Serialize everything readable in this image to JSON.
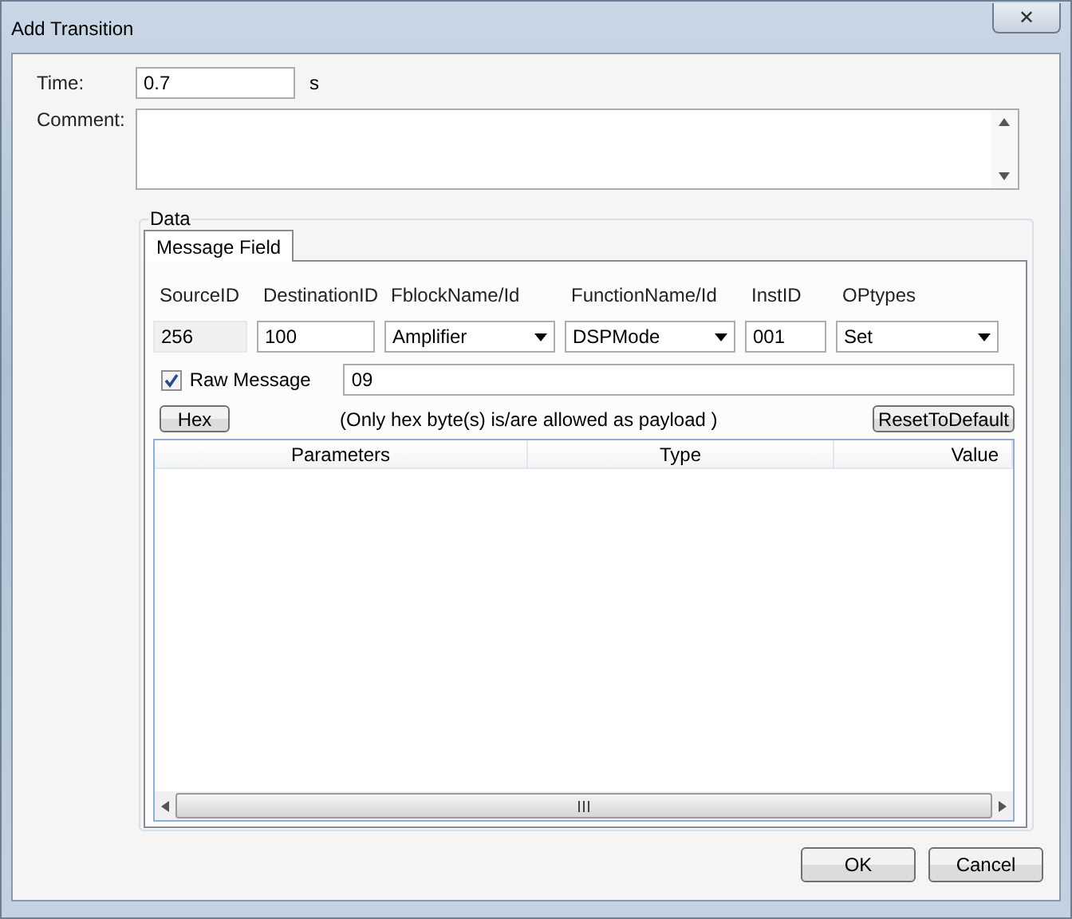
{
  "window": {
    "title": "Add Transition",
    "close": "✕"
  },
  "time": {
    "label": "Time:",
    "value": "0.7",
    "unit": "s"
  },
  "comment": {
    "label": "Comment:"
  },
  "data_group": {
    "label": "Data"
  },
  "tabs": [
    {
      "label": "Message Field",
      "selected": true
    }
  ],
  "fields": [
    {
      "label": "SourceID",
      "value": "256",
      "kind": "text",
      "disabled": true
    },
    {
      "label": "DestinationID",
      "value": "100",
      "kind": "text",
      "disabled": false
    },
    {
      "label": "FblockName/Id",
      "value": "Amplifier",
      "kind": "combo",
      "disabled": false
    },
    {
      "label": "FunctionName/Id",
      "value": "DSPMode",
      "kind": "combo",
      "disabled": false
    },
    {
      "label": "InstID",
      "value": "001",
      "kind": "text",
      "disabled": false
    },
    {
      "label": "OPtypes",
      "value": "Set",
      "kind": "combo",
      "disabled": false
    }
  ],
  "raw_message": {
    "label": "Raw Message",
    "checked": true,
    "value": "09"
  },
  "hex_button": "Hex",
  "note": "(Only hex byte(s) is/are allowed as payload )",
  "reset_button": "ResetToDefault",
  "table": {
    "columns": [
      "Parameters",
      "Type",
      "Value"
    ]
  },
  "buttons": [
    "OK",
    "Cancel"
  ]
}
